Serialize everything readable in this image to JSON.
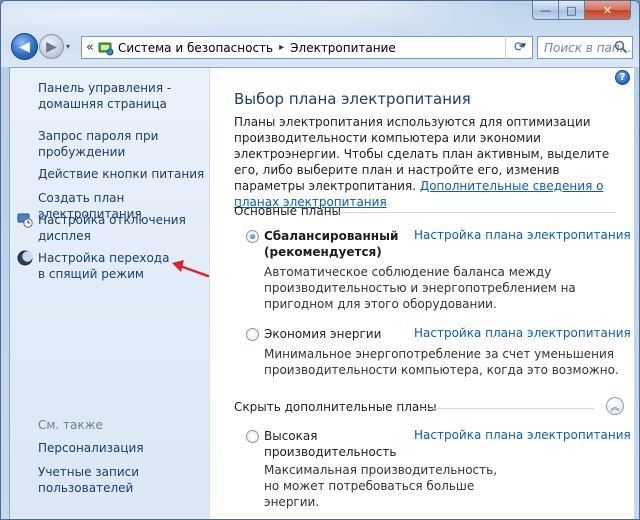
{
  "window": {
    "minimize": "—",
    "maximize": "□",
    "close": "✕"
  },
  "nav": {
    "back": "◀",
    "forward": "▶",
    "history_dropdown": "▾",
    "overflow": "«",
    "breadcrumb": [
      "Система и безопасность",
      "Электропитание"
    ],
    "breadcrumb_separator": "▸",
    "address_dropdown": "▾",
    "refresh": "⟳",
    "search_placeholder": "Поиск в пап..."
  },
  "sidebar": {
    "links": [
      {
        "label": "Панель управления - домашняя страница"
      },
      {
        "label": "Запрос пароля при пробуждении"
      },
      {
        "label": "Действие кнопки питания"
      },
      {
        "label": "Создать план электропитания"
      },
      {
        "label": "Настройка отключения дисплея",
        "icon": "display-clock-icon"
      },
      {
        "label": "Настройка перехода в спящий режим",
        "icon": "moon-icon"
      }
    ],
    "see_also_label": "См. также",
    "see_also": [
      {
        "label": "Персонализация"
      },
      {
        "label": "Учетные записи пользователей"
      }
    ]
  },
  "main": {
    "help": "?",
    "title": "Выбор плана электропитания",
    "intro_text": "Планы электропитания используются для оптимизации производительности компьютера или экономии электроэнергии. Чтобы сделать план активным, выделите его, либо выберите план и настройте его, изменив параметры электропитания.",
    "intro_link": "Дополнительные сведения о планах электропитания",
    "main_plans_header": "Основные планы",
    "hidden_plans_header": "Скрыть дополнительные планы",
    "collapse_icon": "︽",
    "plans": [
      {
        "name": "Сбалансированный (рекомендуется)",
        "selected": true,
        "link": "Настройка плана электропитания",
        "description": "Автоматическое соблюдение баланса между производительностью и энергопотреблением на пригодном для этого оборудовании."
      },
      {
        "name": "Экономия энергии",
        "selected": false,
        "link": "Настройка плана электропитания",
        "description": "Минимальное энергопотребление за счет уменьшения производительности компьютера, когда это возможно."
      },
      {
        "name": "Высокая производительность",
        "selected": false,
        "link": "Настройка плана электропитания",
        "description": "Максимальная производительность, но может потребоваться больше энергии."
      }
    ]
  },
  "colors": {
    "accent_link": "#0a5cc0",
    "title": "#1e3b75",
    "annotation_arrow": "#e0202a"
  }
}
